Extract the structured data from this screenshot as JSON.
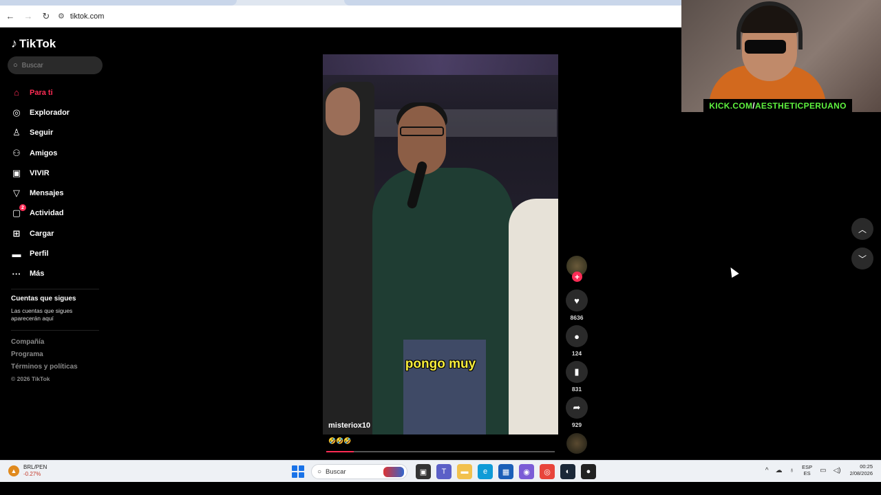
{
  "browser": {
    "url": "tiktok.com"
  },
  "sidebar": {
    "logo": "TikTok",
    "search_placeholder": "Buscar",
    "items": [
      {
        "label": "Para ti",
        "icon": "home-icon",
        "glyph": "⌂",
        "active": true
      },
      {
        "label": "Explorador",
        "icon": "compass-icon",
        "glyph": "◎"
      },
      {
        "label": "Seguir",
        "icon": "user-follow-icon",
        "glyph": "♙"
      },
      {
        "label": "Amigos",
        "icon": "friends-icon",
        "glyph": "⚇"
      },
      {
        "label": "VIVIR",
        "icon": "live-icon",
        "glyph": "▣"
      },
      {
        "label": "Mensajes",
        "icon": "send-icon",
        "glyph": "▽"
      },
      {
        "label": "Actividad",
        "icon": "inbox-icon",
        "glyph": "▢",
        "badge": "2"
      },
      {
        "label": "Cargar",
        "icon": "upload-icon",
        "glyph": "⊞"
      },
      {
        "label": "Perfil",
        "icon": "profile-avatar-icon",
        "glyph": "▬"
      },
      {
        "label": "Más",
        "icon": "more-icon",
        "glyph": "···"
      }
    ],
    "following_title": "Cuentas que sigues",
    "following_desc": "Las cuentas que sigues aparecerán aquí",
    "footer": [
      "Compañía",
      "Programa",
      "Términos y políticas"
    ],
    "copyright": "© 2026 TikTok"
  },
  "video": {
    "caption": "pongo muy",
    "author": "misteriox10",
    "emojis": "🤣🤣🤣",
    "progress": 0.12
  },
  "actions": {
    "likes": "8636",
    "comments": "124",
    "saves": "831",
    "shares": "929"
  },
  "webcam": {
    "banner_part1": "KICK.COM",
    "banner_slash": "/",
    "banner_part2": "AESTHETICPERUANO"
  },
  "taskbar": {
    "weather_title": "BRL/PEN",
    "weather_value": "-0.27%",
    "search": "Buscar",
    "lang1": "ESP",
    "lang2": "ES",
    "time": "00:25",
    "date": "2/08/2026"
  },
  "colors": {
    "accent": "#fe2c55",
    "caption": "#f7ec3c",
    "kick_green": "#5ef23f"
  }
}
